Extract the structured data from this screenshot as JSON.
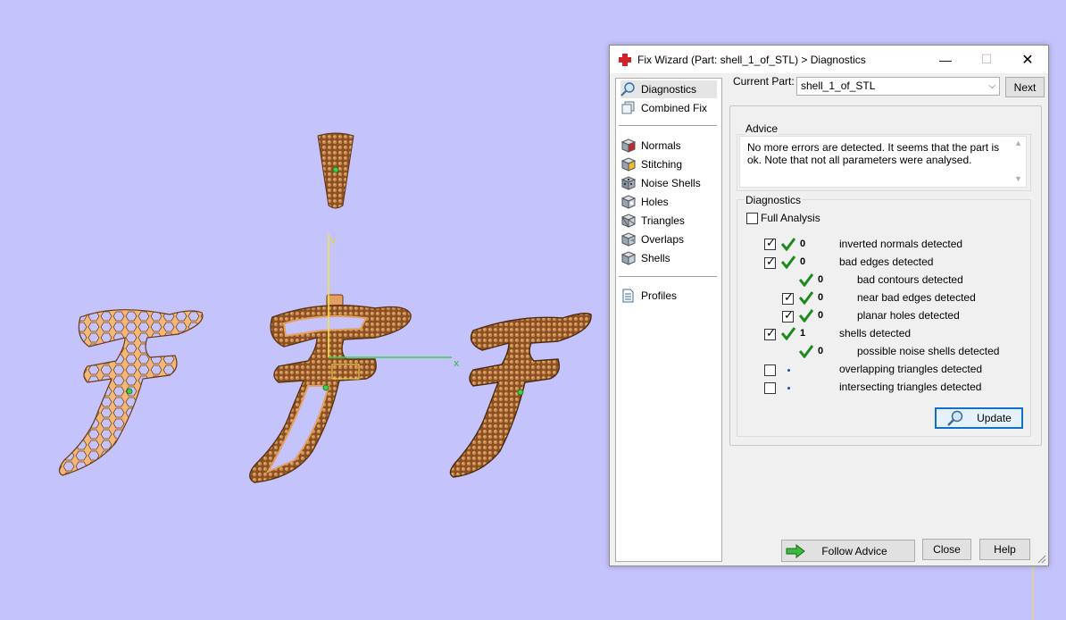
{
  "window": {
    "title": "Fix Wizard (Part: shell_1_of_STL) > Diagnostics",
    "minimize_symbol": "—",
    "maximize_symbol": "☐",
    "close_symbol": "✕"
  },
  "nav": {
    "items": [
      {
        "label": "Diagnostics",
        "icon": "magnifier-icon",
        "selected": true
      },
      {
        "label": "Combined Fix",
        "icon": "combined-fix-icon"
      },
      {
        "label": "Normals",
        "icon": "normals-cube-icon"
      },
      {
        "label": "Stitching",
        "icon": "stitching-cube-icon"
      },
      {
        "label": "Noise Shells",
        "icon": "noise-shells-icon"
      },
      {
        "label": "Holes",
        "icon": "holes-cube-icon"
      },
      {
        "label": "Triangles",
        "icon": "triangles-cube-icon"
      },
      {
        "label": "Overlaps",
        "icon": "overlaps-cube-icon"
      },
      {
        "label": "Shells",
        "icon": "shells-cube-icon"
      },
      {
        "label": "Profiles",
        "icon": "profiles-document-icon"
      }
    ]
  },
  "current_part": {
    "label": "Current Part:",
    "value": "shell_1_of_STL",
    "next_label": "Next"
  },
  "advice": {
    "group_label": "Advice",
    "text": "No more errors are detected. It seems that the part is ok. Note that not all parameters were analysed."
  },
  "diagnostics": {
    "group_label": "Diagnostics",
    "full_analysis_label": "Full Analysis",
    "full_analysis_checked": false,
    "rows": [
      {
        "checkbox": true,
        "checked": true,
        "status": "ok",
        "count": "0",
        "label": "inverted normals detected",
        "indent": 0
      },
      {
        "checkbox": true,
        "checked": true,
        "status": "ok",
        "count": "0",
        "label": "bad edges detected",
        "indent": 0
      },
      {
        "checkbox": false,
        "checked": false,
        "status": "ok",
        "count": "0",
        "label": "bad contours detected",
        "indent": 1
      },
      {
        "checkbox": true,
        "checked": true,
        "status": "ok",
        "count": "0",
        "label": "near bad edges detected",
        "indent": 1
      },
      {
        "checkbox": true,
        "checked": true,
        "status": "ok",
        "count": "0",
        "label": "planar holes detected",
        "indent": 1
      },
      {
        "checkbox": true,
        "checked": true,
        "status": "ok",
        "count": "1",
        "label": "shells detected",
        "indent": 0
      },
      {
        "checkbox": false,
        "checked": false,
        "status": "ok",
        "count": "0",
        "label": "possible noise shells detected",
        "indent": 1
      },
      {
        "checkbox": true,
        "checked": false,
        "status": "pending",
        "count": "",
        "label": "overlapping triangles detected",
        "indent": 0
      },
      {
        "checkbox": true,
        "checked": false,
        "status": "pending",
        "count": "",
        "label": "intersecting triangles detected",
        "indent": 0
      }
    ],
    "update_label": "Update"
  },
  "footer": {
    "follow_advice_label": "Follow Advice",
    "close_label": "Close",
    "help_label": "Help"
  },
  "viewport": {
    "axis_y_label": "y",
    "axis_x_label": "x",
    "colors": {
      "background": "#c4c3fb",
      "part_orange": "#f2b779",
      "part_dark": "#a0632a",
      "axis_yellow": "#f6e24a",
      "axis_green": "#3cd04a",
      "check_green": "#1d8a1d"
    }
  }
}
